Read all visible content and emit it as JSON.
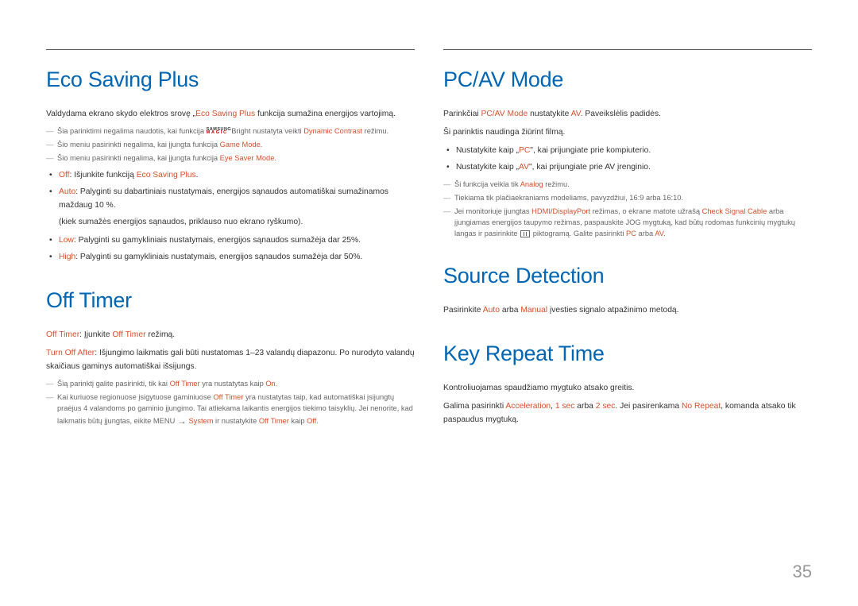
{
  "page_number": "35",
  "left": {
    "eco": {
      "title": "Eco Saving Plus",
      "intro_pre": "Valdydama ekrano skydo elektros srovę „",
      "intro_hl": "Eco Saving Plus",
      "intro_post": " funkcija sumažina energijos vartojimą.",
      "note1_pre": "Šia parinktimi negalima naudotis, kai funkcija ",
      "note1_bright": "Bright",
      "note1_mid": " nustatyta veikti ",
      "note1_hl": "Dynamic Contrast",
      "note1_post": " režimu.",
      "note2_pre": "Šio meniu pasirinkti negalima, kai įjungta funkcija ",
      "note2_hl": "Game Mode",
      "note2_post": ".",
      "note3_pre": "Šio meniu pasirinkti negalima, kai įjungta funkcija ",
      "note3_hl": "Eye Saver Mode",
      "note3_post": ".",
      "b1_hl": "Off",
      "b1_mid": ": Išjunkite funkciją ",
      "b1_hl2": "Eco Saving Plus",
      "b1_post": ".",
      "b2_hl": "Auto",
      "b2_text": ": Palyginti su dabartiniais nustatymais, energijos sąnaudos automatiškai sumažinamos maždaug 10 %.",
      "b2_sub": "(kiek sumažės energijos sąnaudos, priklauso nuo ekrano ryškumo).",
      "b3_hl": "Low",
      "b3_text": ": Palyginti su gamykliniais nustatymais, energijos sąnaudos sumažėja dar 25%.",
      "b4_hl": "High",
      "b4_text": ": Palyginti su gamykliniais nustatymais, energijos sąnaudos sumažėja dar 50%."
    },
    "off": {
      "title": "Off Timer",
      "p1_hl1": "Off Timer",
      "p1_mid": ": Įjunkite ",
      "p1_hl2": "Off Timer",
      "p1_post": " režimą.",
      "p2_hl": "Turn Off After",
      "p2_text": ": Išjungimo laikmatis gali būti nustatomas 1–23 valandų diapazonu. Po nurodyto valandų skaičiaus gaminys automatiškai išsijungs.",
      "n1_pre": "Šią parinktį galite pasirinkti, tik kai ",
      "n1_hl1": "Off Timer",
      "n1_mid": " yra nustatytas kaip ",
      "n1_hl2": "On",
      "n1_post": ".",
      "n2_pre": "Kai kuriuose regionuose įsigytuose gaminiuose ",
      "n2_hl1": "Off Timer",
      "n2_mid1": " yra nustatytas taip, kad automatiškai įsijungtų praėjus 4 valandoms po gaminio įjungimo. Tai atliekama laikantis energijos tiekimo taisyklių. Jei nenorite, kad laikmatis būtų įjungtas, eikite MENU ",
      "n2_hl2": "System",
      "n2_mid2": " ir nustatykite ",
      "n2_hl3": "Off Timer",
      "n2_mid3": " kaip ",
      "n2_hl4": "Off",
      "n2_post": "."
    }
  },
  "right": {
    "pcav": {
      "title": "PC/AV Mode",
      "p1_pre": "Parinkčiai ",
      "p1_hl1": "PC/AV Mode",
      "p1_mid": " nustatykite ",
      "p1_hl2": "AV",
      "p1_post": ". Paveikslėlis padidės.",
      "p2": "Ši parinktis naudinga žiūrint filmą.",
      "b1_pre": "Nustatykite kaip „",
      "b1_hl": "PC",
      "b1_post": "\", kai prijungiate prie kompiuterio.",
      "b2_pre": "Nustatykite kaip „",
      "b2_hl": "AV",
      "b2_post": "\", kai prijungiate prie AV įrenginio.",
      "n1_pre": "Ši funkcija veikia tik ",
      "n1_hl": "Analog",
      "n1_post": " režimu.",
      "n2": "Tiekiama tik plačiaekraniams modeliams, pavyzdžiui, 16:9 arba 16:10.",
      "n3_pre": "Jei monitoriuje įjungtas ",
      "n3_hl1": "HDMI",
      "n3_slash": "/",
      "n3_hl2": "DisplayPort",
      "n3_mid1": " režimas, o ekrane matote užrašą ",
      "n3_hl3": "Check Signal Cable",
      "n3_mid2": " arba įjungiamas energijos taupymo režimas, paspauskite JOG mygtuką, kad būtų rodomas funkcinių mygtukų langas ir pasirinkite ",
      "n3_mid3": " piktogramą. Galite pasirinkti ",
      "n3_hl4": "PC",
      "n3_mid4": " arba ",
      "n3_hl5": "AV",
      "n3_post": "."
    },
    "src": {
      "title": "Source Detection",
      "p_pre": "Pasirinkite ",
      "p_hl1": "Auto",
      "p_mid": " arba ",
      "p_hl2": "Manual",
      "p_post": " įvesties signalo atpažinimo metodą."
    },
    "key": {
      "title": "Key Repeat Time",
      "p1": "Kontroliuojamas spaudžiamo mygtuko atsako greitis.",
      "p2_pre": "Galima pasirinkti ",
      "p2_hl1": "Acceleration",
      "p2_c1": ", ",
      "p2_hl2": "1 sec",
      "p2_mid": " arba ",
      "p2_hl3": "2 sec",
      "p2_mid2": ". Jei pasirenkama ",
      "p2_hl4": "No Repeat",
      "p2_post": ", komanda atsako tik paspaudus mygtuką."
    }
  },
  "logo": {
    "top": "SAMSUNG",
    "bot": "MAGIC"
  }
}
